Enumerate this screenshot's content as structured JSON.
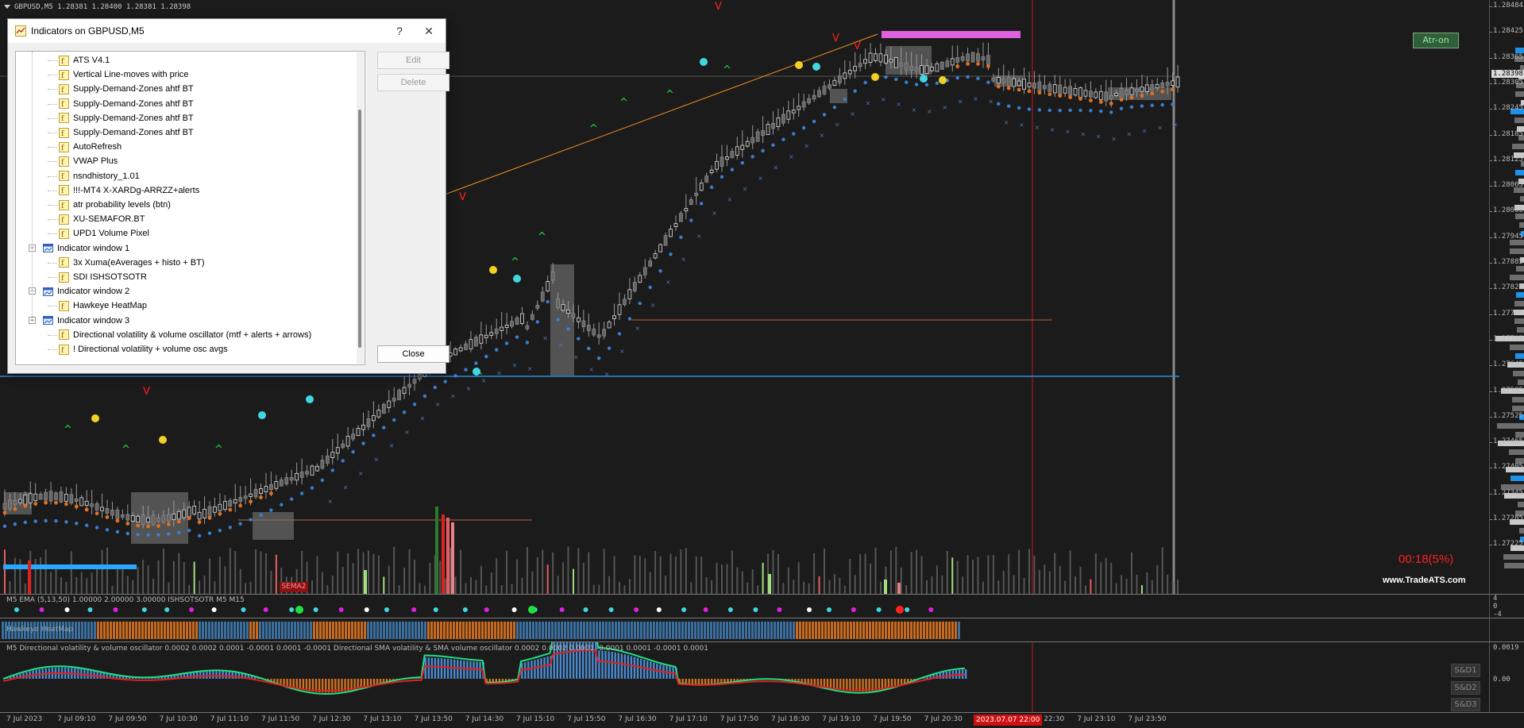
{
  "header": {
    "symbol_line": "GBPUSD,M5  1.28381 1.28400 1.28381 1.28398"
  },
  "price_axis": {
    "labels": [
      "1.28484",
      "1.28425",
      "1.28365",
      "1.28305",
      "1.28245",
      "1.28185",
      "1.28125",
      "1.28065",
      "1.28005",
      "1.27945",
      "1.27885",
      "1.27825",
      "1.27765",
      "1.27705",
      "1.27645",
      "1.27585",
      "1.27525",
      "1.27465",
      "1.27405",
      "1.27345",
      "1.27285",
      "1.27225"
    ],
    "current_price": "1.28398"
  },
  "time_axis": {
    "labels": [
      "7 Jul 2023",
      "7 Jul 09:10",
      "7 Jul 09:50",
      "7 Jul 10:30",
      "7 Jul 11:10",
      "7 Jul 11:50",
      "7 Jul 12:30",
      "7 Jul 13:10",
      "7 Jul 13:50",
      "7 Jul 14:30",
      "7 Jul 15:10",
      "7 Jul 15:50",
      "7 Jul 16:30",
      "7 Jul 17:10",
      "7 Jul 17:50",
      "7 Jul 18:30",
      "7 Jul 19:10",
      "7 Jul 19:50",
      "7 Jul 20:30",
      "7 Jul 21:1",
      "7 Jul 22:30",
      "7 Jul 23:10",
      "7 Jul 23:50"
    ],
    "highlight": "2023.07.07 22:00"
  },
  "dialog": {
    "title": "Indicators on GBPUSD,M5",
    "help": "?",
    "close_x": "✕",
    "items": [
      {
        "label": "ATS V4.1",
        "level": 2
      },
      {
        "label": "Vertical Line-moves with price",
        "level": 2
      },
      {
        "label": "Supply-Demand-Zones ahtf BT",
        "level": 2
      },
      {
        "label": "Supply-Demand-Zones ahtf BT",
        "level": 2
      },
      {
        "label": "Supply-Demand-Zones ahtf BT",
        "level": 2
      },
      {
        "label": "Supply-Demand-Zones ahtf BT",
        "level": 2
      },
      {
        "label": "AutoRefresh",
        "level": 2
      },
      {
        "label": "VWAP Plus",
        "level": 2
      },
      {
        "label": "nsndhistory_1.01",
        "level": 2
      },
      {
        "label": "!!!-MT4 X-XARDg-ARRZZ+alerts",
        "level": 2
      },
      {
        "label": "atr probability levels (btn)",
        "level": 2
      },
      {
        "label": "XU-SEMAFOR.BT",
        "level": 2
      },
      {
        "label": "UPD1 Volume Pixel",
        "level": 2
      },
      {
        "label": "Indicator window 1",
        "level": 1
      },
      {
        "label": "3x Xuma(eAverages + histo + BT)",
        "level": 2
      },
      {
        "label": "SDI ISHSOTSOTR",
        "level": 2
      },
      {
        "label": "Indicator window 2",
        "level": 1
      },
      {
        "label": "Hawkeye HeatMap",
        "level": 2
      },
      {
        "label": "Indicator window 3",
        "level": 1
      },
      {
        "label": "Directional volatility & volume oscillator (mtf + alerts + arrows)",
        "level": 2
      },
      {
        "label": "! Directional volatility + volume osc avgs",
        "level": 2
      }
    ],
    "buttons": {
      "edit": "Edit",
      "delete": "Delete",
      "close": "Close"
    }
  },
  "atr_button": "Atr-on",
  "countdown": "00:18(5%)",
  "watermark": "www.TradeATS.com",
  "sema_label": "SEMA2",
  "subwindows": {
    "w1_caption": "M5 EMA (5,13,50) 1.00000 2.00000 3.00000  ISHSOTSOTR M5 M15",
    "w1_axis": [
      "4",
      "0",
      "-4"
    ],
    "w2_caption": "Hawkeye HeatMap",
    "w3_caption": "M5 Directional volatility & volume oscillator 0.0002 0.0002 0.0001 -0.0001 0.0001 -0.0001  Directional SMA  volatility & SMA  volume oscillator 0.0002 0.0002 0.0001 -0.0001 0.0001 -0.0001 0.0001",
    "w3_axis": [
      "0.0019",
      "0.00"
    ],
    "sd_buttons": [
      "S&D1",
      "S&D2",
      "S&D3"
    ]
  },
  "colors": {
    "bg": "#1b1b1b",
    "bull": "#ffffff",
    "bear": "#808080",
    "dots_blue": "#3a7fd0",
    "dots_orange": "#e07020",
    "hline_blue": "#2a8ce0",
    "zone": "#7a7a7a",
    "magenta": "#e060e0",
    "red": "#ff2020",
    "green": "#20e040"
  }
}
